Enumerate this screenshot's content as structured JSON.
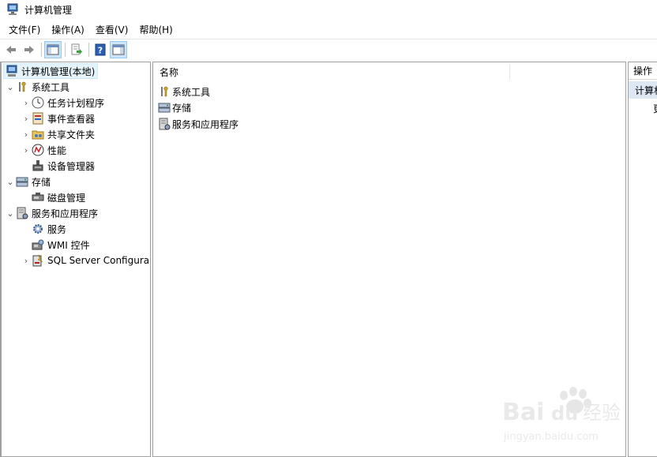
{
  "window": {
    "title": "计算机管理"
  },
  "menubar": {
    "items": [
      "文件(F)",
      "操作(A)",
      "查看(V)",
      "帮助(H)"
    ]
  },
  "toolbar": {
    "icons": [
      "back-arrow-icon",
      "forward-arrow-icon",
      "show-hide-console-tree-icon",
      "export-list-icon",
      "help-icon",
      "show-hide-action-pane-icon"
    ]
  },
  "tree": {
    "root": "计算机管理(本地)",
    "items": [
      {
        "label": "系统工具",
        "icon": "tools-icon",
        "expanded": true
      },
      {
        "label": "任务计划程序",
        "icon": "clock-icon"
      },
      {
        "label": "事件查看器",
        "icon": "event-viewer-icon"
      },
      {
        "label": "共享文件夹",
        "icon": "shared-folder-icon"
      },
      {
        "label": "性能",
        "icon": "performance-icon"
      },
      {
        "label": "设备管理器",
        "icon": "device-manager-icon"
      },
      {
        "label": "存储",
        "icon": "storage-icon",
        "expanded": true
      },
      {
        "label": "磁盘管理",
        "icon": "disk-icon"
      },
      {
        "label": "服务和应用程序",
        "icon": "services-apps-icon",
        "expanded": true
      },
      {
        "label": "服务",
        "icon": "gear-icon"
      },
      {
        "label": "WMI 控件",
        "icon": "wmi-icon"
      },
      {
        "label": "SQL Server Configura",
        "icon": "sql-server-icon"
      }
    ]
  },
  "list": {
    "column_header": "名称",
    "rows": [
      "系统工具",
      "存储",
      "服务和应用程序"
    ]
  },
  "actions": {
    "header": "操作",
    "section": "计算机",
    "item": "更"
  },
  "watermark": {
    "line1": "Bai",
    "line1b": "du",
    "line1c": "经验",
    "line2": "jingyan.baidu.com"
  }
}
